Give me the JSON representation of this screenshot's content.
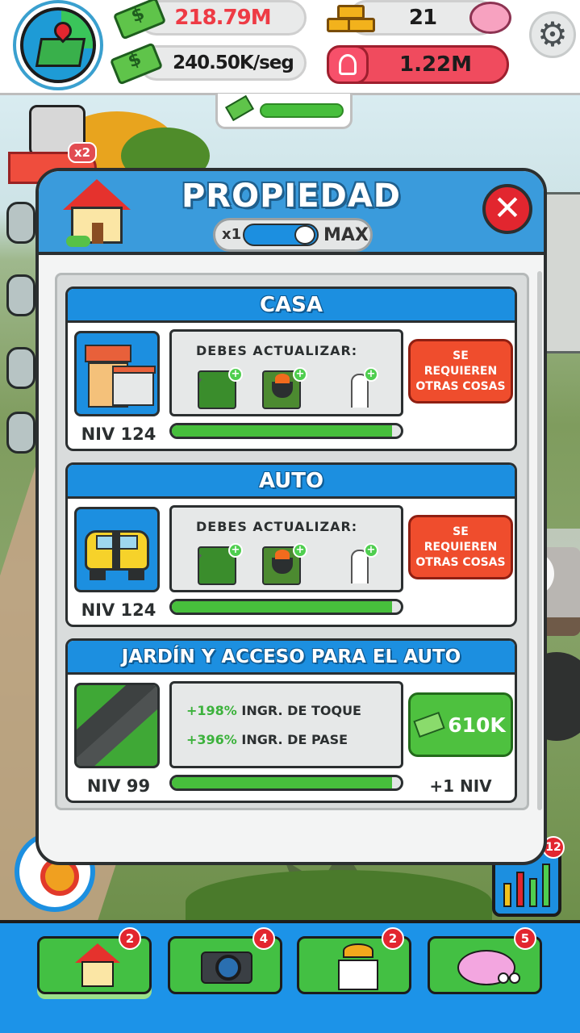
{
  "topbar": {
    "money": "218.79M",
    "income_rate": "240.50K/seg",
    "gold": "21",
    "followers": "1.22M",
    "icons": [
      "map-icon",
      "cash-stack-icon",
      "gold-bars-icon",
      "piggy-bank-icon",
      "person-icon",
      "gear-icon"
    ]
  },
  "boost": {
    "progress": 1.0,
    "icon": "cash-icon"
  },
  "video_boost": {
    "badge": "x2",
    "icon": "play-icon"
  },
  "modal": {
    "title": "PROPIEDAD",
    "toggle": {
      "left_label": "x1",
      "right_label": "MAX",
      "state": "max"
    },
    "close_icon": "close-x-icon",
    "cards": [
      {
        "title": "CASA",
        "level": "NIV 124",
        "requires_title": "DEBES ACTUALIZAR:",
        "progress": 0.96,
        "button": "SE REQUIEREN OTRAS COSAS",
        "required_icons": [
          "driveway-icon",
          "grill-icon",
          "garden-gnome-icon"
        ]
      },
      {
        "title": "AUTO",
        "level": "NIV 124",
        "requires_title": "DEBES ACTUALIZAR:",
        "progress": 0.96,
        "button": "SE REQUIEREN OTRAS COSAS",
        "required_icons": [
          "driveway-icon",
          "grill-icon",
          "garden-gnome-icon"
        ]
      },
      {
        "title": "JARDÍN Y ACCESO PARA EL AUTO",
        "level": "NIV 99",
        "bonuses": [
          {
            "pct": "+198%",
            "label": "INGR. DE TOQUE"
          },
          {
            "pct": "+396%",
            "label": "INGR. DE PASE"
          }
        ],
        "progress": 0.96,
        "price": "610K",
        "next_level": "+1 NIV"
      }
    ]
  },
  "stats_badge": "12",
  "nav": [
    {
      "icon": "house-icon",
      "badge": "2",
      "active": true
    },
    {
      "icon": "camera-icon",
      "badge": "4",
      "active": false
    },
    {
      "icon": "tshirt-icon",
      "badge": "2",
      "active": false
    },
    {
      "icon": "brain-icon",
      "badge": "5",
      "active": false
    }
  ]
}
